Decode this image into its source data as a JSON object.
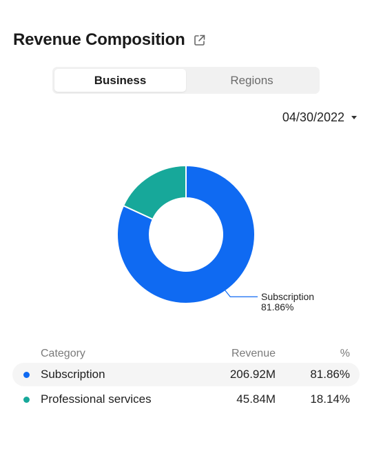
{
  "header": {
    "title": "Revenue Composition",
    "share_icon": "external-share-icon"
  },
  "tabs": [
    {
      "label": "Business",
      "active": true
    },
    {
      "label": "Regions",
      "active": false
    }
  ],
  "date_select": {
    "value": "04/30/2022"
  },
  "colors": {
    "subscription": "#0f6af2",
    "professional_services": "#17a89a",
    "callout_line": "#0f6af2"
  },
  "chart_data": {
    "type": "pie",
    "variant": "donut",
    "categories": [
      "Subscription",
      "Professional services"
    ],
    "values": [
      81.86,
      18.14
    ],
    "callout": {
      "label": "Subscription",
      "value": "81.86%"
    }
  },
  "table": {
    "headers": {
      "category": "Category",
      "revenue": "Revenue",
      "percent": "%"
    },
    "rows": [
      {
        "category": "Subscription",
        "revenue": "206.92M",
        "percent": "81.86%"
      },
      {
        "category": "Professional services",
        "revenue": "45.84M",
        "percent": "18.14%"
      }
    ]
  }
}
